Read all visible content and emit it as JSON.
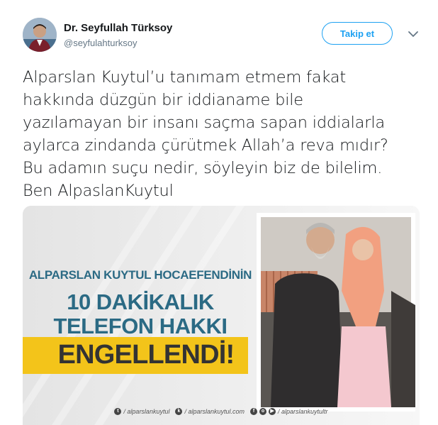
{
  "user": {
    "name": "Dr. Seyfullah Türksoy",
    "handle": "@seyfulahturksoy",
    "follow_label": "Takip et"
  },
  "tweet": {
    "lines": [
      "Alparslan Kuytul’u tanımam etmem fakat",
      "hakkında düzgün bir iddianame bile",
      "yazılamayan bir insanı saçma sapan iddialarla",
      "aylarca zindanda çürütmek Allah’a reva mıdır?",
      "Bu adamın suçu nedir, söyleyin biz de bilelim.",
      "Ben AlpaslanKuytul"
    ]
  },
  "media": {
    "headline_1": "ALPARSLAN KUYTUL HOCAEFENDİNİN",
    "headline_2": "10 DAKİKALIK",
    "headline_3": "TELEFON HAKKI",
    "banner": "ENGELLENDİ!",
    "footer": {
      "twitter": "/ alparslankuytul",
      "web": "/ alparslankuytul.com",
      "social": "/ alparslankuytultr"
    }
  },
  "colors": {
    "accent": "#1da1f2",
    "headline": "#2b6a84",
    "banner": "#f3c41a"
  },
  "icons": {
    "menu": "chevron-down-icon"
  }
}
